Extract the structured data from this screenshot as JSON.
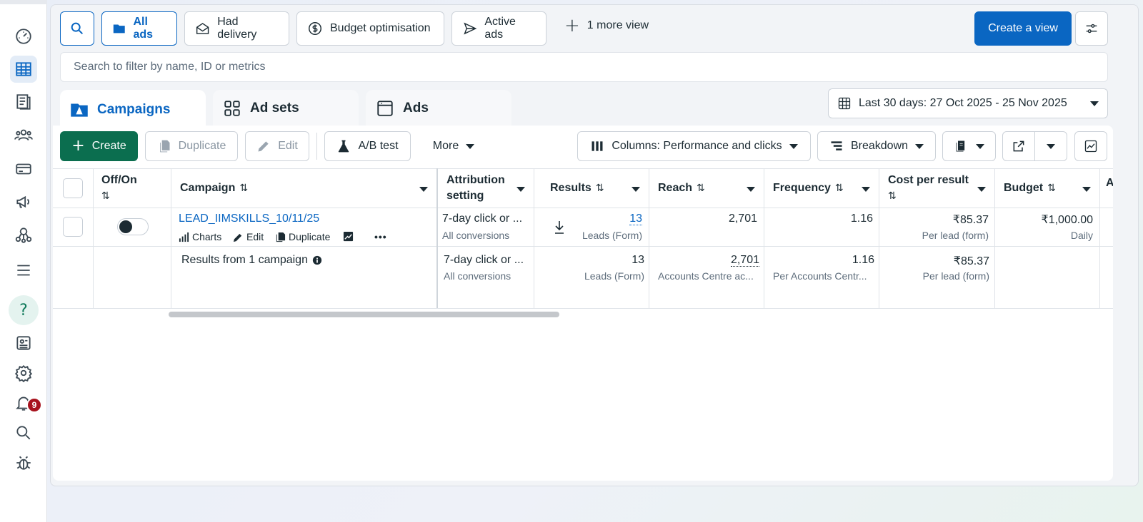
{
  "views": {
    "all_ads": "All ads",
    "had_delivery": "Had delivery",
    "budget_optimisation": "Budget optimisation",
    "active_ads": "Active ads",
    "more_view": "1 more view",
    "create_view": "Create a view"
  },
  "filter": {
    "placeholder": "Search to filter by name, ID or metrics"
  },
  "tabs": {
    "campaigns": "Campaigns",
    "ad_sets": "Ad sets",
    "ads": "Ads"
  },
  "date_range": "Last 30 days: 27 Oct 2025 - 25 Nov 2025",
  "toolbar": {
    "create": "Create",
    "duplicate": "Duplicate",
    "edit": "Edit",
    "ab_test": "A/B test",
    "more": "More",
    "columns": "Columns: Performance and clicks",
    "breakdown": "Breakdown"
  },
  "table": {
    "headers": {
      "off_on": "Off/On",
      "campaign": "Campaign",
      "attribution": "Attribution setting",
      "results": "Results",
      "reach": "Reach",
      "frequency": "Frequency",
      "cost_per_result": "Cost per result",
      "budget": "Budget",
      "partial": "A"
    },
    "row": {
      "name": "LEAD_IIMSKILLS_10/11/25",
      "actions": {
        "charts": "Charts",
        "edit": "Edit",
        "duplicate": "Duplicate",
        "more": "•••"
      },
      "attribution": "7-day click or ...",
      "attribution_sub": "All conversions",
      "results": "13",
      "results_sub": "Leads (Form)",
      "reach": "2,701",
      "frequency": "1.16",
      "cost": "₹85.37",
      "cost_sub": "Per lead (form)",
      "budget": "₹1,000.00",
      "budget_sub": "Daily"
    },
    "summary": {
      "label": "Results from 1 campaign",
      "attribution": "7-day click or ...",
      "attribution_sub": "All conversions",
      "results": "13",
      "results_sub": "Leads (Form)",
      "reach": "2,701",
      "reach_sub": "Accounts Centre ac...",
      "frequency": "1.16",
      "frequency_sub": "Per Accounts Centr...",
      "cost": "₹85.37",
      "cost_sub": "Per lead (form)"
    }
  },
  "notifications": {
    "count": "9"
  },
  "colors": {
    "brand_blue": "#0a66c2",
    "create_green": "#0b6e4f",
    "badge_red": "#a7121d"
  }
}
